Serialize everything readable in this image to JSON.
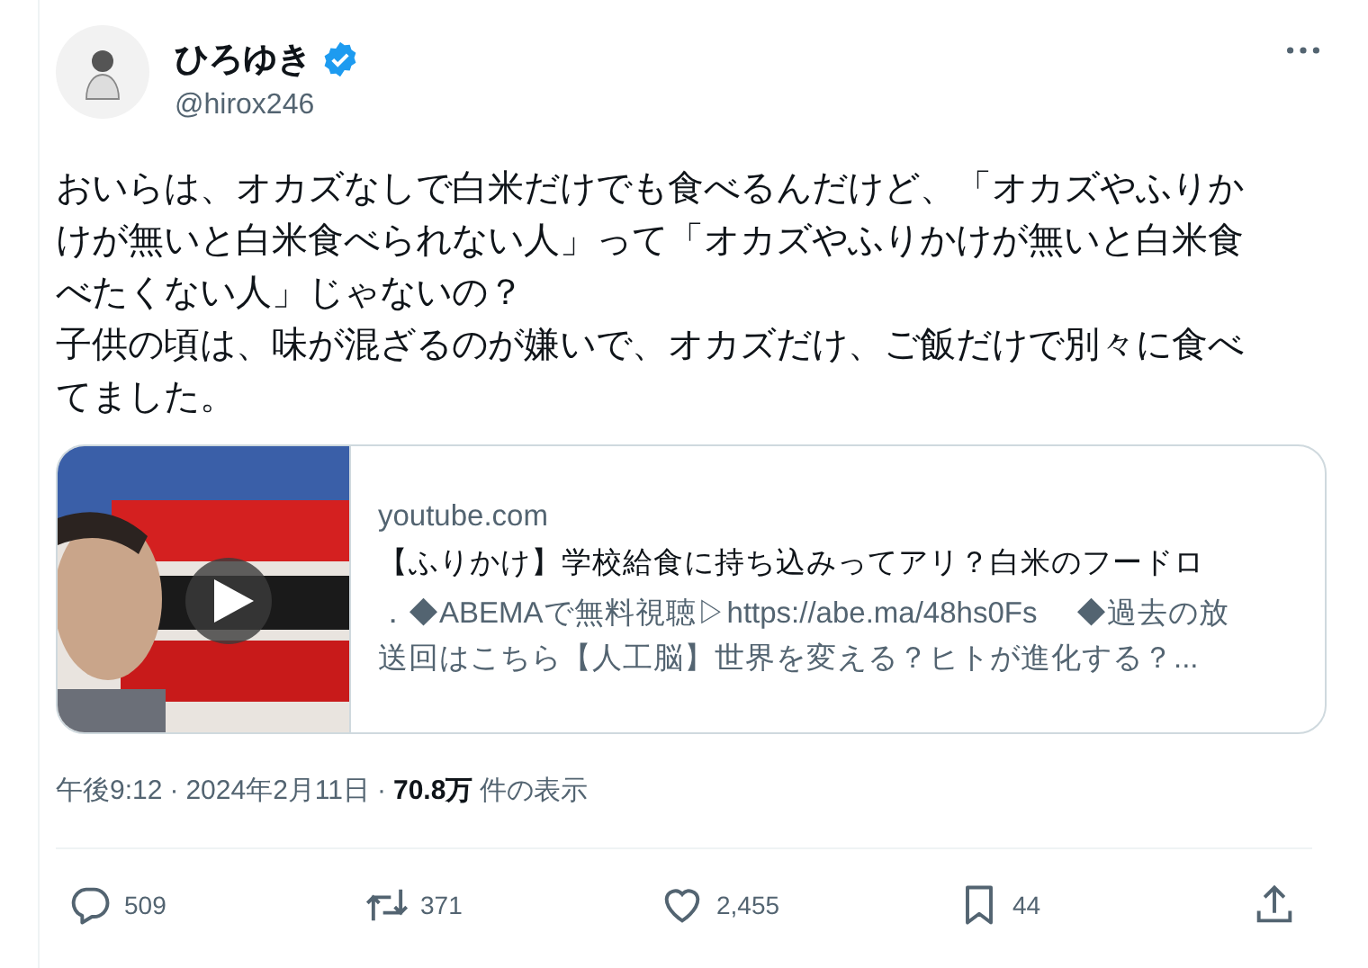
{
  "author": {
    "name": "ひろゆき",
    "verified": true,
    "handle": "@hirox246"
  },
  "body": [
    "おいらは、オカズなしで白米だけでも食べるんだけど、「オカズやふりかけが無いと白米食べられない人」って「オカズやふりかけが無いと白米食べたくない人」じゃないの？",
    "子供の頃は、味が混ざるのが嫌いで、オカズだけ、ご飯だけで別々に食べてました。"
  ],
  "link_card": {
    "kind": "picture",
    "domain": "youtube.com",
    "title": "【ふりかけ】学校給食に持ち込みってアリ？白米のフードロ",
    "description": [
      "．◆ABEMAで無料視聴▷https://abe.ma/48hs0Fs　 ◆過去の放",
      "送回はこちら【人工脳】世界を変える？ヒトが進化する？..."
    ]
  },
  "meta": {
    "time": "午後9:12",
    "separator": "·",
    "date": "2024年2月11日",
    "views": "70.8万",
    "views_label": "件の表示"
  },
  "actions": [
    {
      "kind": "reply",
      "count": "509"
    },
    {
      "kind": "repost",
      "count": "371"
    },
    {
      "kind": "like",
      "count": "2,455"
    },
    {
      "kind": "bookmark",
      "count": "44"
    },
    {
      "kind": "share"
    }
  ]
}
